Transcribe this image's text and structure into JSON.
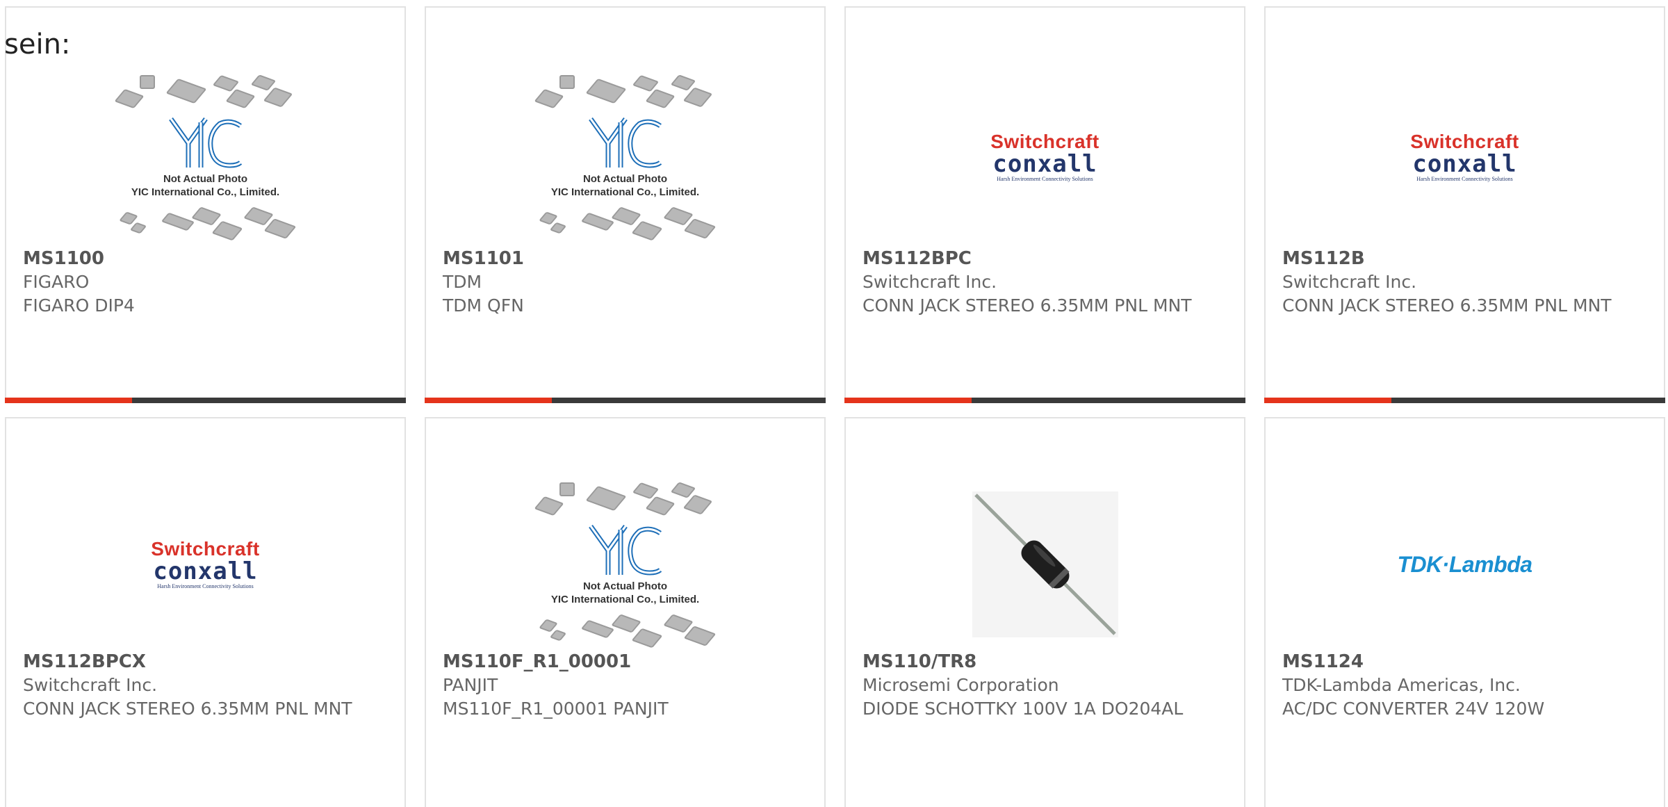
{
  "page": {
    "label": "sein:"
  },
  "placeholder": {
    "line1": "Not Actual Photo",
    "line2": "YIC International Co., Limited."
  },
  "logos": {
    "switchcraft_top": "Switchcraft",
    "switchcraft_mid": "conxall",
    "switchcraft_sub": "Harsh Environment Connectivity Solutions",
    "tdk": "TDK·Lambda"
  },
  "colors": {
    "accent": "#e5341b",
    "bar": "#3a3a3a",
    "border": "#e2e2e2"
  },
  "products": [
    {
      "part": "MS1100",
      "manufacturer": "FIGARO",
      "description": "FIGARO DIP4",
      "image": "yic-placeholder"
    },
    {
      "part": "MS1101",
      "manufacturer": "TDM",
      "description": "TDM QFN",
      "image": "yic-placeholder"
    },
    {
      "part": "MS112BPC",
      "manufacturer": "Switchcraft Inc.",
      "description": "CONN JACK STEREO 6.35MM PNL MNT",
      "image": "switchcraft-logo"
    },
    {
      "part": "MS112B",
      "manufacturer": "Switchcraft Inc.",
      "description": "CONN JACK STEREO 6.35MM PNL MNT",
      "image": "switchcraft-logo"
    },
    {
      "part": "MS112BPCX",
      "manufacturer": "Switchcraft Inc.",
      "description": "CONN JACK STEREO 6.35MM PNL MNT",
      "image": "switchcraft-logo"
    },
    {
      "part": "MS110F_R1_00001",
      "manufacturer": "PANJIT",
      "description": "MS110F_R1_00001 PANJIT",
      "image": "yic-placeholder"
    },
    {
      "part": "MS110/TR8",
      "manufacturer": "Microsemi Corporation",
      "description": "DIODE SCHOTTKY 100V 1A DO204AL",
      "image": "diode-photo"
    },
    {
      "part": "MS1124",
      "manufacturer": "TDK-Lambda Americas, Inc.",
      "description": "AC/DC CONVERTER 24V 120W",
      "image": "tdk-lambda-logo"
    }
  ]
}
